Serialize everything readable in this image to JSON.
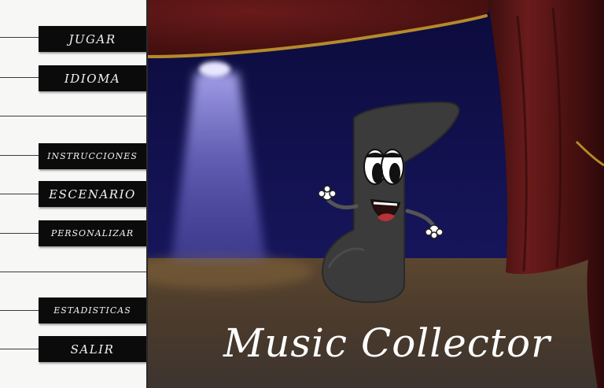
{
  "game": {
    "title": "Music Collector"
  },
  "menu": {
    "items": [
      {
        "id": "jugar",
        "label": "JUGAR"
      },
      {
        "id": "idioma",
        "label": "IDIOMA"
      },
      {
        "id": "instrucciones",
        "label": "INSTRUCCIONES"
      },
      {
        "id": "escenario",
        "label": "ESCENARIO"
      },
      {
        "id": "personalizar",
        "label": "PERSONALIZAR"
      },
      {
        "id": "estadisticas",
        "label": "ESTADISTICAS"
      },
      {
        "id": "salir",
        "label": "SALIR"
      }
    ]
  },
  "scene": {
    "background": "theater-stage",
    "mascot": "music-note-character",
    "colors": {
      "curtain": "#5a1414",
      "curtain_rope": "#b58a2a",
      "backdrop": "#13124a",
      "spotlight": "#8a86e0",
      "floor": "#4a3a2a",
      "key_black": "#0b0b0b",
      "key_white": "#f7f7f5",
      "mascot_body": "#3b3b3b"
    }
  }
}
